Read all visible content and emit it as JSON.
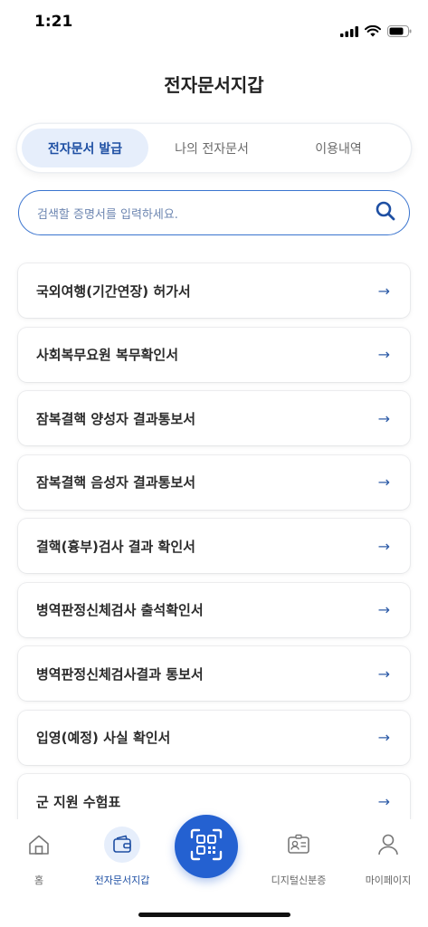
{
  "status_bar": {
    "time": "1:21"
  },
  "header": {
    "title": "전자문서지갑"
  },
  "tabs": [
    {
      "label": "전자문서 발급",
      "active": true
    },
    {
      "label": "나의 전자문서",
      "active": false
    },
    {
      "label": "이용내역",
      "active": false
    }
  ],
  "search": {
    "placeholder": "검색할 증명서를 입력하세요."
  },
  "documents": [
    {
      "label": "국외여행(기간연장) 허가서"
    },
    {
      "label": "사회복무요원 복무확인서"
    },
    {
      "label": "잠복결핵 양성자 결과통보서"
    },
    {
      "label": "잠복결핵 음성자 결과통보서"
    },
    {
      "label": "결핵(흉부)검사 결과 확인서"
    },
    {
      "label": "병역판정신체검사 출석확인서"
    },
    {
      "label": "병역판정신체검사결과 통보서"
    },
    {
      "label": "입영(예정) 사실 확인서"
    },
    {
      "label": "군 지원 수험표"
    }
  ],
  "bottom_nav": {
    "home": "홈",
    "wallet": "전자문서지갑",
    "digital_id": "디지털신분증",
    "mypage": "마이페이지",
    "active": "wallet"
  },
  "colors": {
    "accent": "#2461d1",
    "active_tab_bg": "#e6eefb",
    "active_text": "#1e4fa3"
  },
  "icons": {
    "search": "search-icon",
    "arrow": "arrow-right-icon",
    "home": "home-icon",
    "wallet": "wallet-icon",
    "qr": "qr-scan-icon",
    "id_card": "id-card-icon",
    "person": "person-icon"
  }
}
